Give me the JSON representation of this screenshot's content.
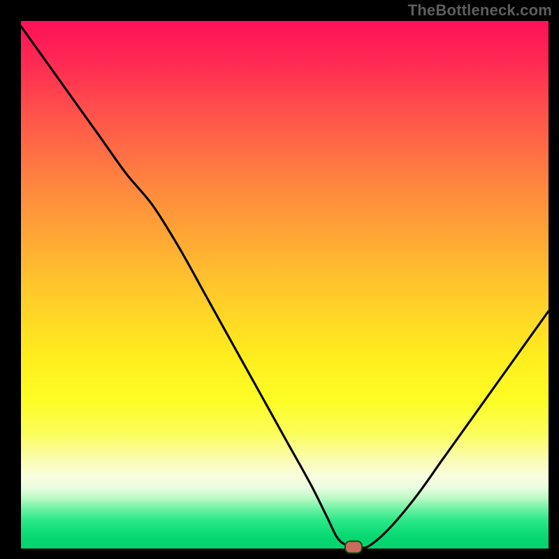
{
  "attribution": "TheBottleneck.com",
  "colors": {
    "page_bg": "#000000",
    "attribution_text": "#5e5e5e",
    "curve_stroke": "#000000",
    "marker_fill": "#cb6a5f",
    "marker_border": "#0a4f0f"
  },
  "chart_data": {
    "type": "line",
    "title": "",
    "xlabel": "",
    "ylabel": "",
    "xlim": [
      0,
      100
    ],
    "ylim": [
      0,
      100
    ],
    "grid": false,
    "legend": false,
    "background": "gradient red→yellow→green (top→bottom)",
    "series": [
      {
        "name": "bottleneck-curve",
        "x": [
          0,
          5,
          10,
          15,
          20,
          25,
          30,
          35,
          40,
          45,
          50,
          55,
          58,
          60,
          62,
          64,
          66,
          70,
          75,
          80,
          85,
          90,
          95,
          100
        ],
        "y": [
          99,
          92,
          85,
          78,
          71,
          65,
          57,
          48,
          39,
          30,
          21,
          12,
          6,
          2,
          0.5,
          0.2,
          0.5,
          4,
          10,
          17,
          24,
          31,
          38,
          45
        ]
      }
    ],
    "marker": {
      "x": 63,
      "y": 0.2
    }
  }
}
